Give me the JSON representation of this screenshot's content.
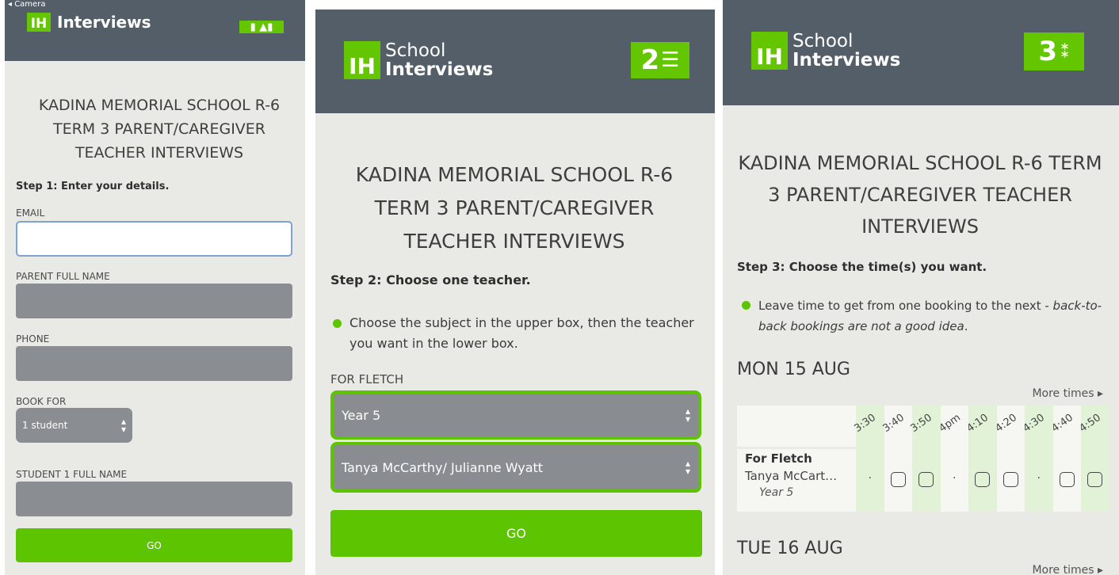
{
  "colors": {
    "header": "#545e69",
    "accent": "#63c600",
    "background": "#e9e9e5",
    "field": "#8a8d91"
  },
  "status_bar": {
    "back_label": "◂ Camera"
  },
  "logo": {
    "line1": "School",
    "line2": "Interviews",
    "mark": "IH"
  },
  "title": "KADINA MEMORIAL SCHOOL R-6 TERM 3 PARENT/CAREGIVER TEACHER INTERVIEWS",
  "screen1": {
    "step_heading": "Step 1: Enter your details.",
    "email_label": "EMAIL",
    "email_value": "",
    "parent_label": "PARENT FULL NAME",
    "phone_label": "PHONE",
    "bookfor_label": "BOOK FOR",
    "bookfor_value": "1 student",
    "student_label": "STUDENT 1 FULL NAME",
    "go_label": "GO"
  },
  "screen2": {
    "step_badge": "2",
    "step_heading": "Step 2: Choose one teacher.",
    "bullet": "Choose the subject in the upper box, then the teacher you want in the lower box.",
    "for_label": "FOR FLETCH",
    "subject_value": "Year 5",
    "teacher_value": "Tanya McCarthy/ Julianne Wyatt",
    "go_label": "GO"
  },
  "screen3": {
    "step_badge": "3",
    "step_heading": "Step 3: Choose the time(s) you want.",
    "bullet_plain": "Leave time to get from one booking to the next - ",
    "bullet_italic": "back-to-back bookings are not a good idea",
    "bullet_end": ".",
    "day1": "MON 15 AUG",
    "more_times": "More times ▸",
    "times": [
      "3:30",
      "3:40",
      "3:50",
      "4pm",
      "4:10",
      "4:20",
      "4:30",
      "4:40",
      "4:50"
    ],
    "slots": [
      "dot",
      "box",
      "box",
      "dot",
      "box",
      "box",
      "dot",
      "box",
      "box"
    ],
    "row_for": "For Fletch",
    "row_teacher": "Tanya McCart…",
    "row_year": "Year 5",
    "day2": "TUE 16 AUG",
    "more_times2": "More times ▸"
  }
}
